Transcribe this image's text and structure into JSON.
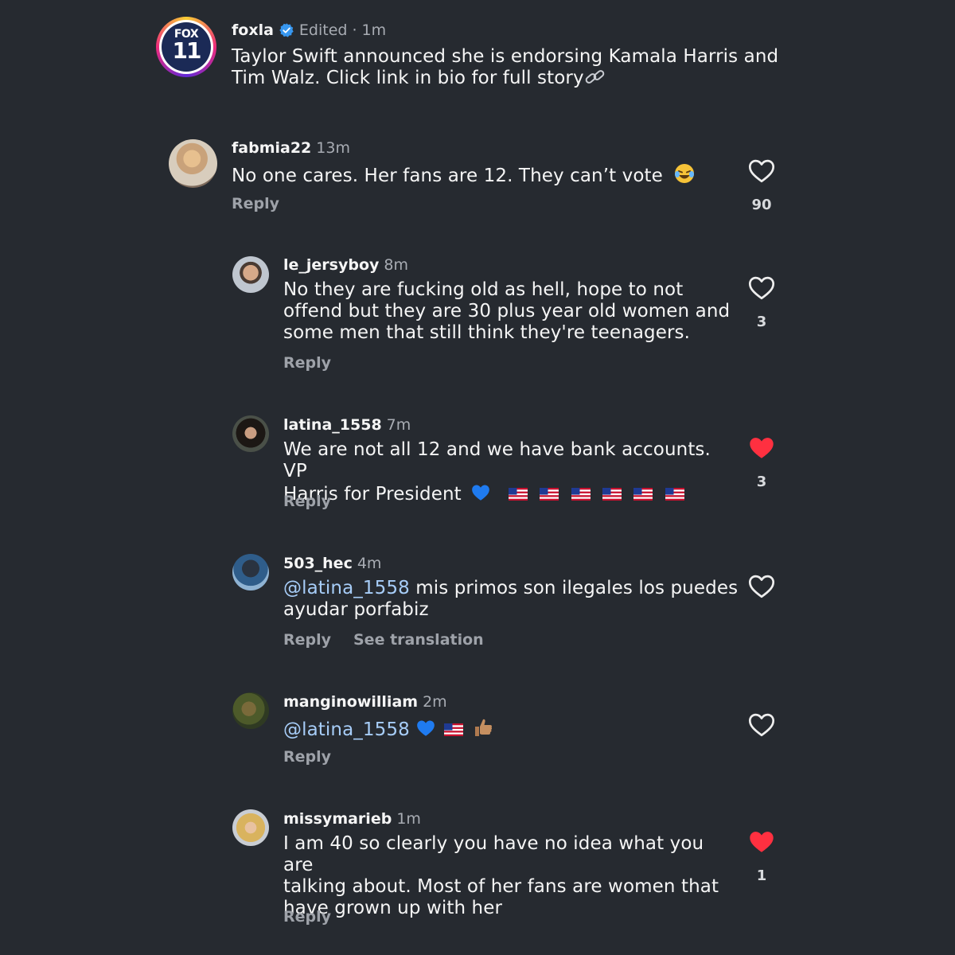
{
  "post": {
    "username": "foxla",
    "edited": "Edited",
    "sep": "·",
    "time": "1m",
    "text": "Taylor Swift announced she is endorsing Kamala Harris and Tim Walz. Click link in bio for full story",
    "logo_top": "FOX",
    "logo_num": "11"
  },
  "comments": [
    {
      "username": "fabmia22",
      "time": "13m",
      "text": "No one cares.  Her fans are 12. They can’t vote",
      "reply": "Reply",
      "likes": "90",
      "liked": false
    },
    {
      "username": "le_jersyboy",
      "time": "8m",
      "lines": [
        "No they are fucking old as hell, hope to not",
        "offend but they are 30 plus year old women and",
        "some men that still think they're teenagers."
      ],
      "reply": "Reply",
      "likes": "3",
      "liked": false
    },
    {
      "username": "latina_1558",
      "time": "7m",
      "lines": [
        "We are not all 12 and we have bank accounts. VP",
        "Harris for President"
      ],
      "reply": "Reply",
      "likes": "3",
      "liked": true
    },
    {
      "username": "503_hec",
      "time": "4m",
      "mention": "@latina_1558",
      "lines": [
        " mis primos son ilegales los puedes",
        "ayudar porfabiz"
      ],
      "reply": "Reply",
      "translate": "See translation",
      "liked": false
    },
    {
      "username": "manginowilliam",
      "time": "2m",
      "mention": "@latina_1558",
      "reply": "Reply",
      "liked": false
    },
    {
      "username": "missymarieb",
      "time": "1m",
      "lines": [
        "I am 40 so clearly you have no idea what you are",
        "talking about. Most of her fans are women that",
        "have grown up with her"
      ],
      "reply": "Reply",
      "likes": "1",
      "liked": true
    }
  ],
  "icons": {
    "heart": "heart-icon",
    "verified": "verified-badge-icon",
    "link": "link-icon"
  },
  "colors": {
    "background": "#262a30",
    "liked": "#ff3040",
    "mention": "#a7cdf8",
    "muted": "#a8acb3"
  }
}
